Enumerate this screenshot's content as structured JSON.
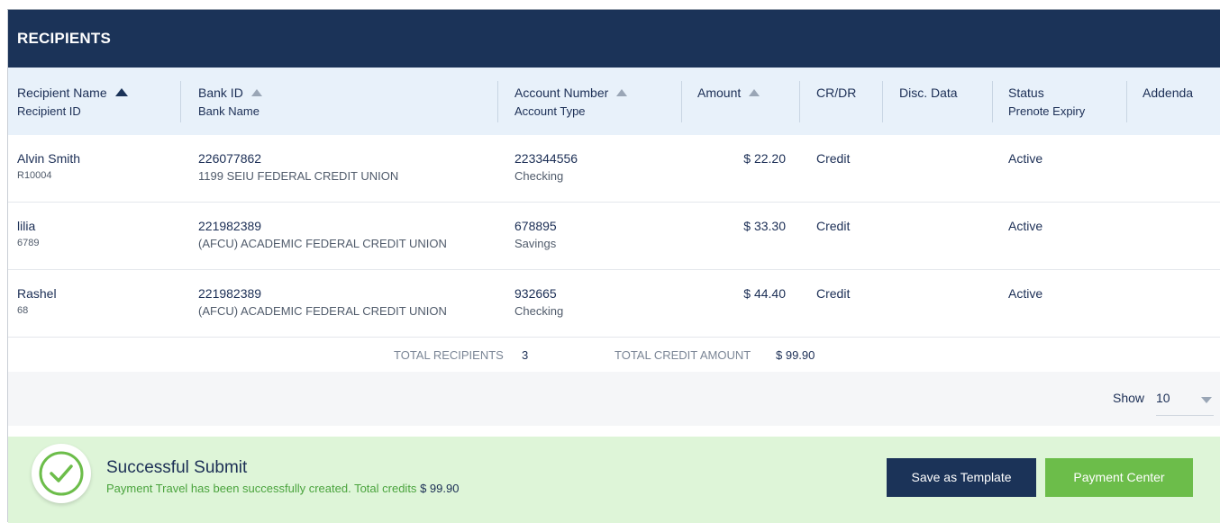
{
  "panel": {
    "title": "RECIPIENTS"
  },
  "columns": {
    "recipient": {
      "label": "Recipient Name",
      "sub": "Recipient ID"
    },
    "bank": {
      "label": "Bank ID",
      "sub": "Bank Name"
    },
    "account": {
      "label": "Account Number",
      "sub": "Account Type"
    },
    "amount": {
      "label": "Amount"
    },
    "crdr": {
      "label": "CR/DR"
    },
    "disc": {
      "label": "Disc. Data"
    },
    "status": {
      "label": "Status",
      "sub": "Prenote Expiry"
    },
    "addenda": {
      "label": "Addenda"
    }
  },
  "rows": [
    {
      "name": "Alvin Smith",
      "id": "R10004",
      "bank_id": "226077862",
      "bank_name": "1199 SEIU FEDERAL CREDIT UNION",
      "account": "223344556",
      "account_type": "Checking",
      "amount": "$ 22.20",
      "crdr": "Credit",
      "status": "Active"
    },
    {
      "name": "lilia",
      "id": "6789",
      "bank_id": "221982389",
      "bank_name": "(AFCU) ACADEMIC FEDERAL CREDIT UNION",
      "account": "678895",
      "account_type": "Savings",
      "amount": "$ 33.30",
      "crdr": "Credit",
      "status": "Active"
    },
    {
      "name": "Rashel",
      "id": "68",
      "bank_id": "221982389",
      "bank_name": "(AFCU) ACADEMIC FEDERAL CREDIT UNION",
      "account": "932665",
      "account_type": "Checking",
      "amount": "$ 44.40",
      "crdr": "Credit",
      "status": "Active"
    }
  ],
  "totals": {
    "recipients_label": "TOTAL RECIPIENTS",
    "recipients_value": "3",
    "credit_label": "TOTAL CREDIT AMOUNT",
    "credit_value": "$ 99.90"
  },
  "pager": {
    "show_label": "Show",
    "page_size": "10"
  },
  "success": {
    "title": "Successful Submit",
    "message": "Payment Travel has been successfully created. Total credits",
    "amount": "$ 99.90",
    "icon": "check-circle-icon"
  },
  "buttons": {
    "save_template": "Save as Template",
    "payment_center": "Payment Center"
  },
  "colors": {
    "navy": "#1b3358",
    "success_bg": "#def5d8",
    "green": "#6cbd4a"
  }
}
